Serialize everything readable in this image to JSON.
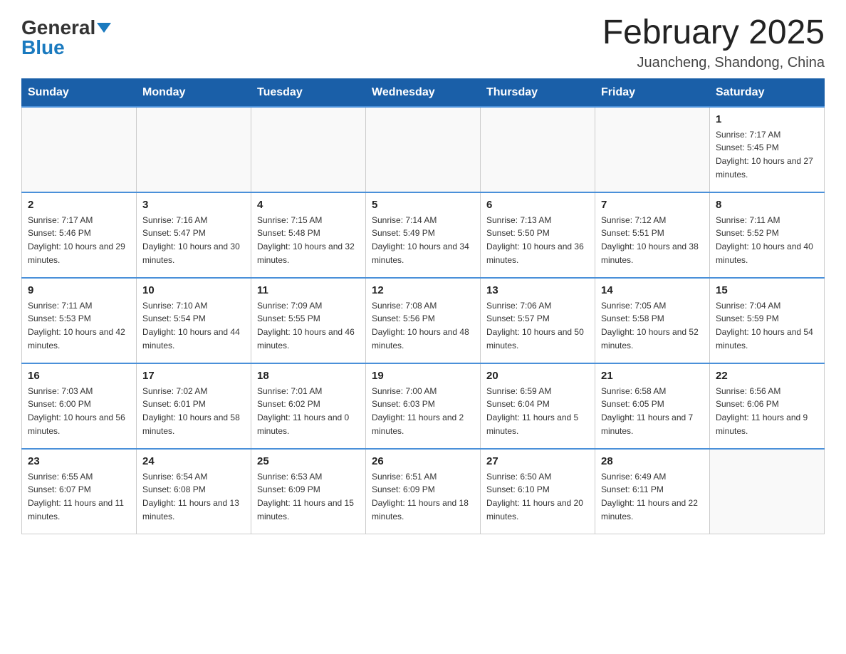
{
  "logo": {
    "general": "General",
    "blue": "Blue"
  },
  "title": "February 2025",
  "location": "Juancheng, Shandong, China",
  "days_of_week": [
    "Sunday",
    "Monday",
    "Tuesday",
    "Wednesday",
    "Thursday",
    "Friday",
    "Saturday"
  ],
  "weeks": [
    [
      null,
      null,
      null,
      null,
      null,
      null,
      {
        "day": "1",
        "sunrise": "7:17 AM",
        "sunset": "5:45 PM",
        "daylight": "10 hours and 27 minutes."
      }
    ],
    [
      {
        "day": "2",
        "sunrise": "7:17 AM",
        "sunset": "5:46 PM",
        "daylight": "10 hours and 29 minutes."
      },
      {
        "day": "3",
        "sunrise": "7:16 AM",
        "sunset": "5:47 PM",
        "daylight": "10 hours and 30 minutes."
      },
      {
        "day": "4",
        "sunrise": "7:15 AM",
        "sunset": "5:48 PM",
        "daylight": "10 hours and 32 minutes."
      },
      {
        "day": "5",
        "sunrise": "7:14 AM",
        "sunset": "5:49 PM",
        "daylight": "10 hours and 34 minutes."
      },
      {
        "day": "6",
        "sunrise": "7:13 AM",
        "sunset": "5:50 PM",
        "daylight": "10 hours and 36 minutes."
      },
      {
        "day": "7",
        "sunrise": "7:12 AM",
        "sunset": "5:51 PM",
        "daylight": "10 hours and 38 minutes."
      },
      {
        "day": "8",
        "sunrise": "7:11 AM",
        "sunset": "5:52 PM",
        "daylight": "10 hours and 40 minutes."
      }
    ],
    [
      {
        "day": "9",
        "sunrise": "7:11 AM",
        "sunset": "5:53 PM",
        "daylight": "10 hours and 42 minutes."
      },
      {
        "day": "10",
        "sunrise": "7:10 AM",
        "sunset": "5:54 PM",
        "daylight": "10 hours and 44 minutes."
      },
      {
        "day": "11",
        "sunrise": "7:09 AM",
        "sunset": "5:55 PM",
        "daylight": "10 hours and 46 minutes."
      },
      {
        "day": "12",
        "sunrise": "7:08 AM",
        "sunset": "5:56 PM",
        "daylight": "10 hours and 48 minutes."
      },
      {
        "day": "13",
        "sunrise": "7:06 AM",
        "sunset": "5:57 PM",
        "daylight": "10 hours and 50 minutes."
      },
      {
        "day": "14",
        "sunrise": "7:05 AM",
        "sunset": "5:58 PM",
        "daylight": "10 hours and 52 minutes."
      },
      {
        "day": "15",
        "sunrise": "7:04 AM",
        "sunset": "5:59 PM",
        "daylight": "10 hours and 54 minutes."
      }
    ],
    [
      {
        "day": "16",
        "sunrise": "7:03 AM",
        "sunset": "6:00 PM",
        "daylight": "10 hours and 56 minutes."
      },
      {
        "day": "17",
        "sunrise": "7:02 AM",
        "sunset": "6:01 PM",
        "daylight": "10 hours and 58 minutes."
      },
      {
        "day": "18",
        "sunrise": "7:01 AM",
        "sunset": "6:02 PM",
        "daylight": "11 hours and 0 minutes."
      },
      {
        "day": "19",
        "sunrise": "7:00 AM",
        "sunset": "6:03 PM",
        "daylight": "11 hours and 2 minutes."
      },
      {
        "day": "20",
        "sunrise": "6:59 AM",
        "sunset": "6:04 PM",
        "daylight": "11 hours and 5 minutes."
      },
      {
        "day": "21",
        "sunrise": "6:58 AM",
        "sunset": "6:05 PM",
        "daylight": "11 hours and 7 minutes."
      },
      {
        "day": "22",
        "sunrise": "6:56 AM",
        "sunset": "6:06 PM",
        "daylight": "11 hours and 9 minutes."
      }
    ],
    [
      {
        "day": "23",
        "sunrise": "6:55 AM",
        "sunset": "6:07 PM",
        "daylight": "11 hours and 11 minutes."
      },
      {
        "day": "24",
        "sunrise": "6:54 AM",
        "sunset": "6:08 PM",
        "daylight": "11 hours and 13 minutes."
      },
      {
        "day": "25",
        "sunrise": "6:53 AM",
        "sunset": "6:09 PM",
        "daylight": "11 hours and 15 minutes."
      },
      {
        "day": "26",
        "sunrise": "6:51 AM",
        "sunset": "6:09 PM",
        "daylight": "11 hours and 18 minutes."
      },
      {
        "day": "27",
        "sunrise": "6:50 AM",
        "sunset": "6:10 PM",
        "daylight": "11 hours and 20 minutes."
      },
      {
        "day": "28",
        "sunrise": "6:49 AM",
        "sunset": "6:11 PM",
        "daylight": "11 hours and 22 minutes."
      },
      null
    ]
  ]
}
